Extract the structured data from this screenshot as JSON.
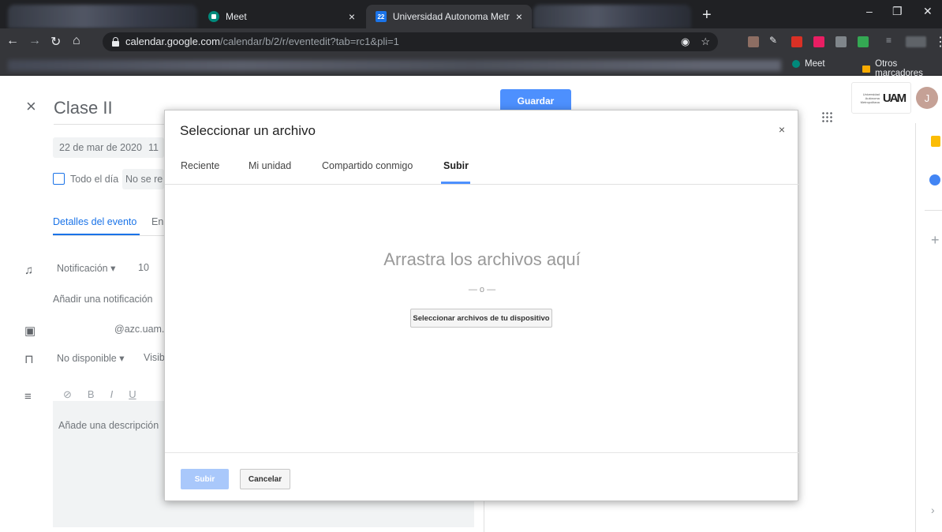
{
  "browser": {
    "tabs": [
      {
        "label": "Meet",
        "close": "×"
      },
      {
        "label": "Universidad Autonoma Metropol",
        "icon_text": "22",
        "close": "×"
      }
    ],
    "new_tab": "+",
    "window_controls": {
      "minimize": "–",
      "restore": "❐",
      "close": "✕"
    },
    "url_host": "calendar.google.com",
    "url_path": "/calendar/b/2/r/eventedit?tab=rc1&pli=1",
    "bookmarks": {
      "meet": "Meet",
      "other": "Otros marcadores"
    }
  },
  "calendar": {
    "close_icon": "×",
    "title": "Clase II",
    "save_label": "Guardar",
    "date": "22 de mar de 2020",
    "time_fragment": "11",
    "all_day": "Todo el día",
    "repeat_fragment": "No se re",
    "tab_details": "Detalles del evento",
    "tab_other_fragment": "En",
    "notification_type": "Notificación",
    "notification_value": "10",
    "add_notification": "Añadir una notificación",
    "calendar_email": "@azc.uam.r",
    "availability": "No disponible",
    "visibility_fragment": "Visib",
    "description_placeholder": "Añade una descripción",
    "format_tools": [
      "B",
      "I",
      "U"
    ],
    "avatar_letter": "J",
    "logo_text": "Universidad Autónoma Metropolitana",
    "logo_mark": "UAM"
  },
  "dialog": {
    "title": "Seleccionar un archivo",
    "close": "×",
    "tabs": [
      "Reciente",
      "Mi unidad",
      "Compartido conmigo",
      "Subir"
    ],
    "active_tab": "Subir",
    "drop_text": "Arrastra los archivos aquí",
    "or_text": "— o —",
    "select_button": "Seleccionar archivos de tu dispositivo",
    "upload_button": "Subir",
    "cancel_button": "Cancelar"
  },
  "colors": {
    "accent": "#4d90fe",
    "chrome_dark": "#202124"
  }
}
